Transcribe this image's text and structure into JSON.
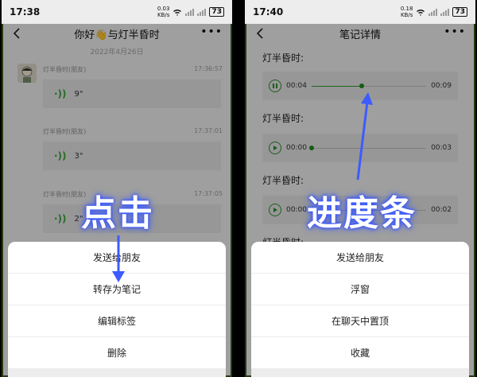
{
  "left": {
    "status": {
      "time": "17:38",
      "net_speed": "0.03",
      "net_unit": "KB/s",
      "battery": "73"
    },
    "header": {
      "title": "你好👋与灯半昏时"
    },
    "chat": {
      "date": "2022年4月26日",
      "messages": [
        {
          "sender": "灯半昏时(朋友)",
          "time": "17:36:57",
          "duration": "9\""
        },
        {
          "sender": "灯半昏时(朋友)",
          "time": "17:37:01",
          "duration": "3\""
        },
        {
          "sender": "灯半昏时(朋友)",
          "time": "17:37:05",
          "duration": "2\""
        }
      ]
    },
    "sheet": {
      "items": [
        "发送给朋友",
        "转存为笔记",
        "编辑标签",
        "删除"
      ]
    },
    "overlay_label": "点击"
  },
  "right": {
    "status": {
      "time": "17:40",
      "net_speed": "0.18",
      "net_unit": "KB/s",
      "battery": "73"
    },
    "header": {
      "title": "笔记详情"
    },
    "note": {
      "items": [
        {
          "label": "灯半昏时:",
          "current": "00:04",
          "total": "00:09",
          "progress": 0.44,
          "state": "paused"
        },
        {
          "label": "灯半昏时:",
          "current": "00:00",
          "total": "00:03",
          "progress": 0.0,
          "state": "stopped"
        },
        {
          "label": "灯半昏时:",
          "current": "00:00",
          "total": "00:02",
          "progress": 0.0,
          "state": "stopped"
        },
        {
          "label": "灯半昏时:"
        }
      ]
    },
    "sheet": {
      "items": [
        "发送给朋友",
        "浮窗",
        "在聊天中置顶",
        "收藏"
      ]
    },
    "overlay_label": "进度条"
  },
  "colors": {
    "accent_green": "#2a9a2a",
    "annotation_blue": "#3c5cff"
  }
}
